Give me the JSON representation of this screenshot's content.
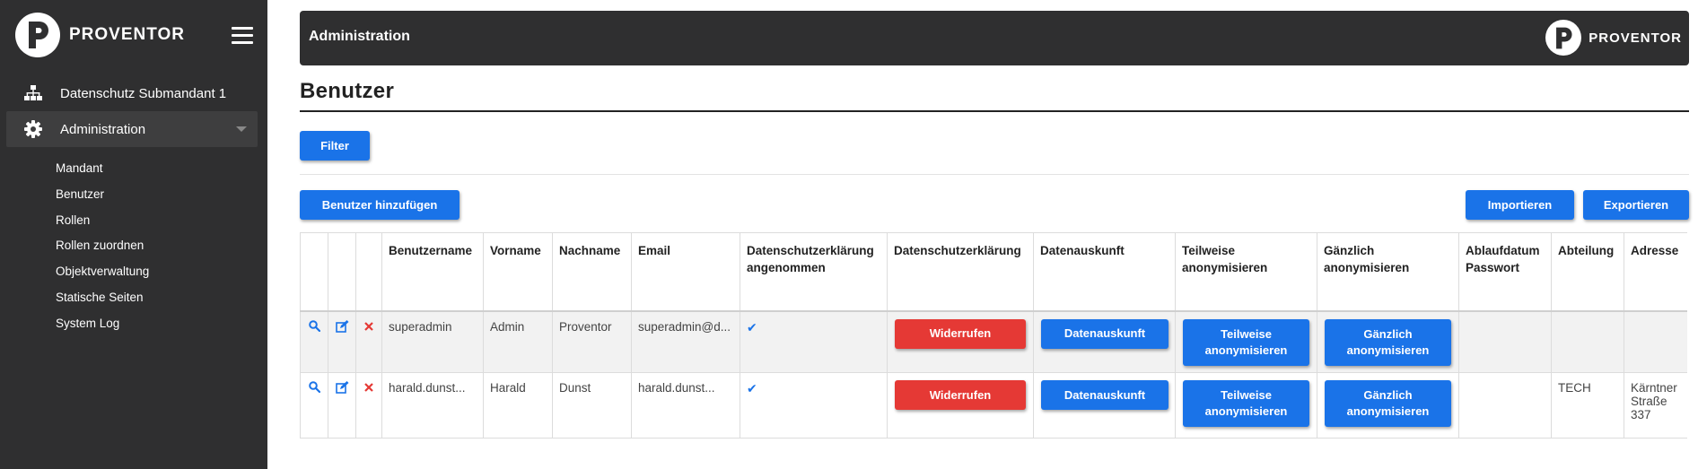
{
  "brand": {
    "name": "PROVENTOR",
    "letter": "P"
  },
  "sidebar": {
    "main_items": [
      {
        "label": "Datenschutz Submandant 1",
        "icon": "sitemap-icon"
      },
      {
        "label": "Administration",
        "icon": "gear-icon",
        "active": true
      }
    ],
    "sub_items": [
      {
        "label": "Mandant"
      },
      {
        "label": "Benutzer"
      },
      {
        "label": "Rollen"
      },
      {
        "label": "Rollen zuordnen"
      },
      {
        "label": "Objektverwaltung"
      },
      {
        "label": "Statische Seiten"
      },
      {
        "label": "System Log"
      }
    ]
  },
  "topbar": {
    "title": "Administration"
  },
  "page": {
    "title": "Benutzer"
  },
  "toolbar": {
    "filter_label": "Filter",
    "add_user_label": "Benutzer hinzufügen",
    "import_label": "Importieren",
    "export_label": "Exportieren"
  },
  "table": {
    "headers": {
      "username": "Benutzername",
      "firstname": "Vorname",
      "lastname": "Nachname",
      "email": "Email",
      "privacy_accepted": "Datenschutzerklärung angenommen",
      "privacy": "Datenschutzerklärung",
      "data_info": "Datenauskunft",
      "partial_anon": "Teilweise anonymisieren",
      "full_anon": "Gänzlich anonymisieren",
      "pw_expiry": "Ablaufdatum Passwort",
      "department": "Abteilung",
      "address": "Adresse"
    },
    "rows": [
      {
        "username": "superadmin",
        "firstname": "Admin",
        "lastname": "Proventor",
        "email": "superadmin@d...",
        "privacy_accepted": "✔",
        "revoke_label": "Widerrufen",
        "data_info_label": "Datenauskunft",
        "partial_anon_label": "Teilweise anonymisieren",
        "full_anon_label": "Gänzlich anonymisieren",
        "pw_expiry": "",
        "department": "",
        "address": ""
      },
      {
        "username": "harald.dunst...",
        "firstname": "Harald",
        "lastname": "Dunst",
        "email": "harald.dunst...",
        "privacy_accepted": "✔",
        "revoke_label": "Widerrufen",
        "data_info_label": "Datenauskunft",
        "partial_anon_label": "Teilweise anonymisieren",
        "full_anon_label": "Gänzlich anonymisieren",
        "pw_expiry": "",
        "department": "TECH",
        "address": "Kärntner Straße 337"
      }
    ]
  },
  "colors": {
    "primary": "#1a73e8",
    "danger": "#e53935",
    "dark": "#2f2f30"
  }
}
